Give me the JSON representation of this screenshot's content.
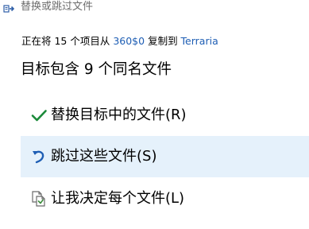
{
  "window": {
    "title": "替换或跳过文件",
    "title_icon": "file-move-icon"
  },
  "summary": {
    "prefix": "正在将 15 个项目从 ",
    "source": "360$0",
    "middle": " 复制到 ",
    "destination": "Terraria"
  },
  "heading": "目标包含 9 个同名文件",
  "options": [
    {
      "label": "替换目标中的文件(R)",
      "icon": "checkmark-icon",
      "icon_color": "#1b8a3a"
    },
    {
      "label": "跳过这些文件(S)",
      "icon": "undo-arrow-icon",
      "icon_color": "#1e5eb4"
    },
    {
      "label": "让我决定每个文件(L)",
      "icon": "compare-files-icon",
      "icon_color": "#3a8a3a"
    }
  ],
  "colors": {
    "link": "#1e5eb4",
    "hover_background": "#e5f1fb",
    "title_text": "#6d6d6d"
  }
}
